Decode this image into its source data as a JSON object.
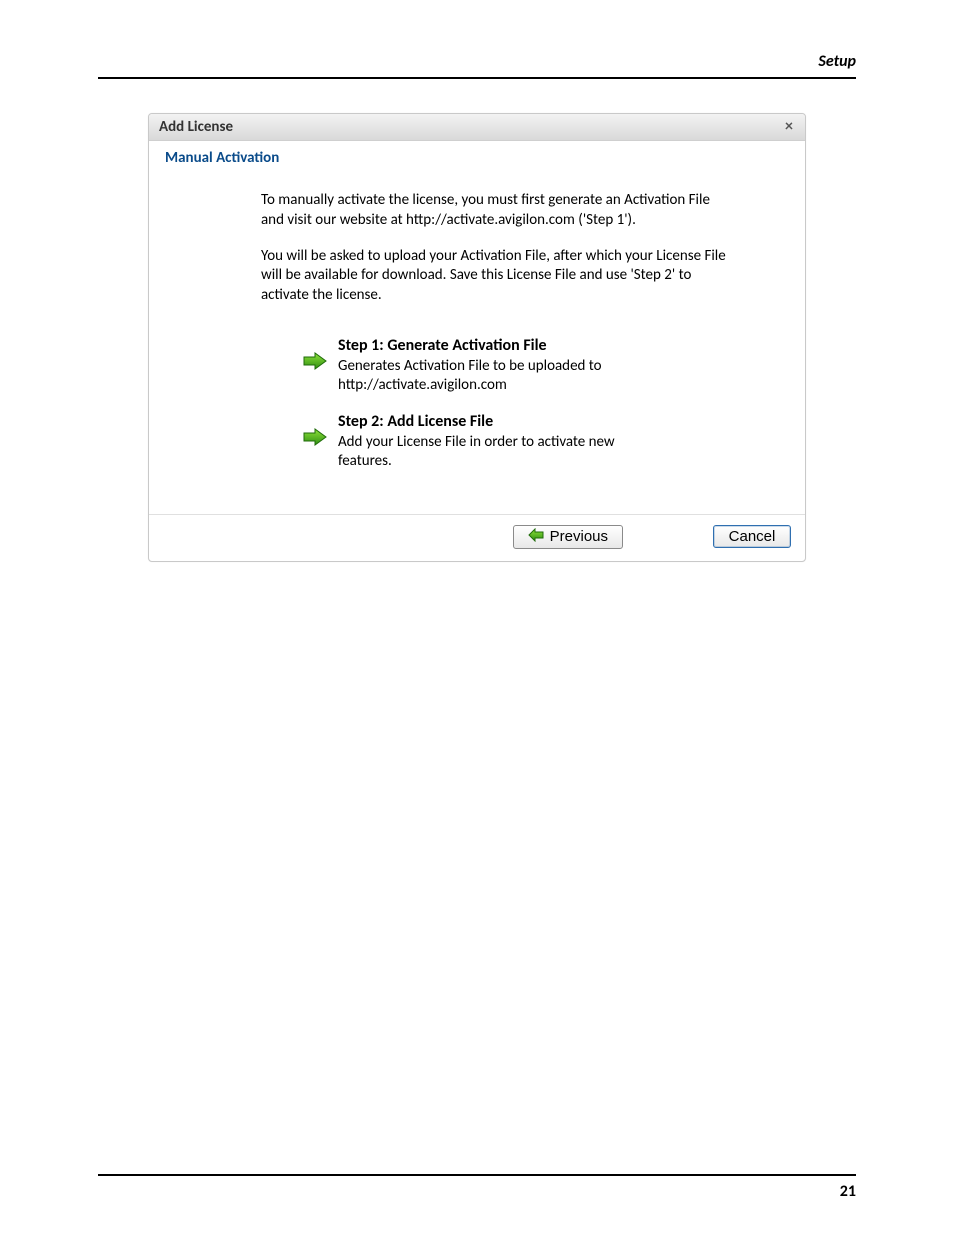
{
  "pageHeader": "Setup",
  "pageNumber": "21",
  "dialog": {
    "title": "Add License",
    "closeGlyph": "×",
    "subheading": "Manual Activation",
    "para1": "To manually activate the license, you must first generate an Activation File and visit our website at http://activate.avigilon.com ('Step 1').",
    "para2": "You will be asked to upload your Activation File, after which your License File will be available for download. Save this License File and use 'Step 2' to activate the license.",
    "steps": [
      {
        "title": "Step 1: Generate Activation File",
        "desc": "Generates Activation File to be uploaded to http://activate.avigilon.com"
      },
      {
        "title": "Step 2: Add License File",
        "desc": "Add your License File in order to activate new features."
      }
    ],
    "buttons": {
      "previous": "Previous",
      "cancel": "Cancel"
    }
  }
}
